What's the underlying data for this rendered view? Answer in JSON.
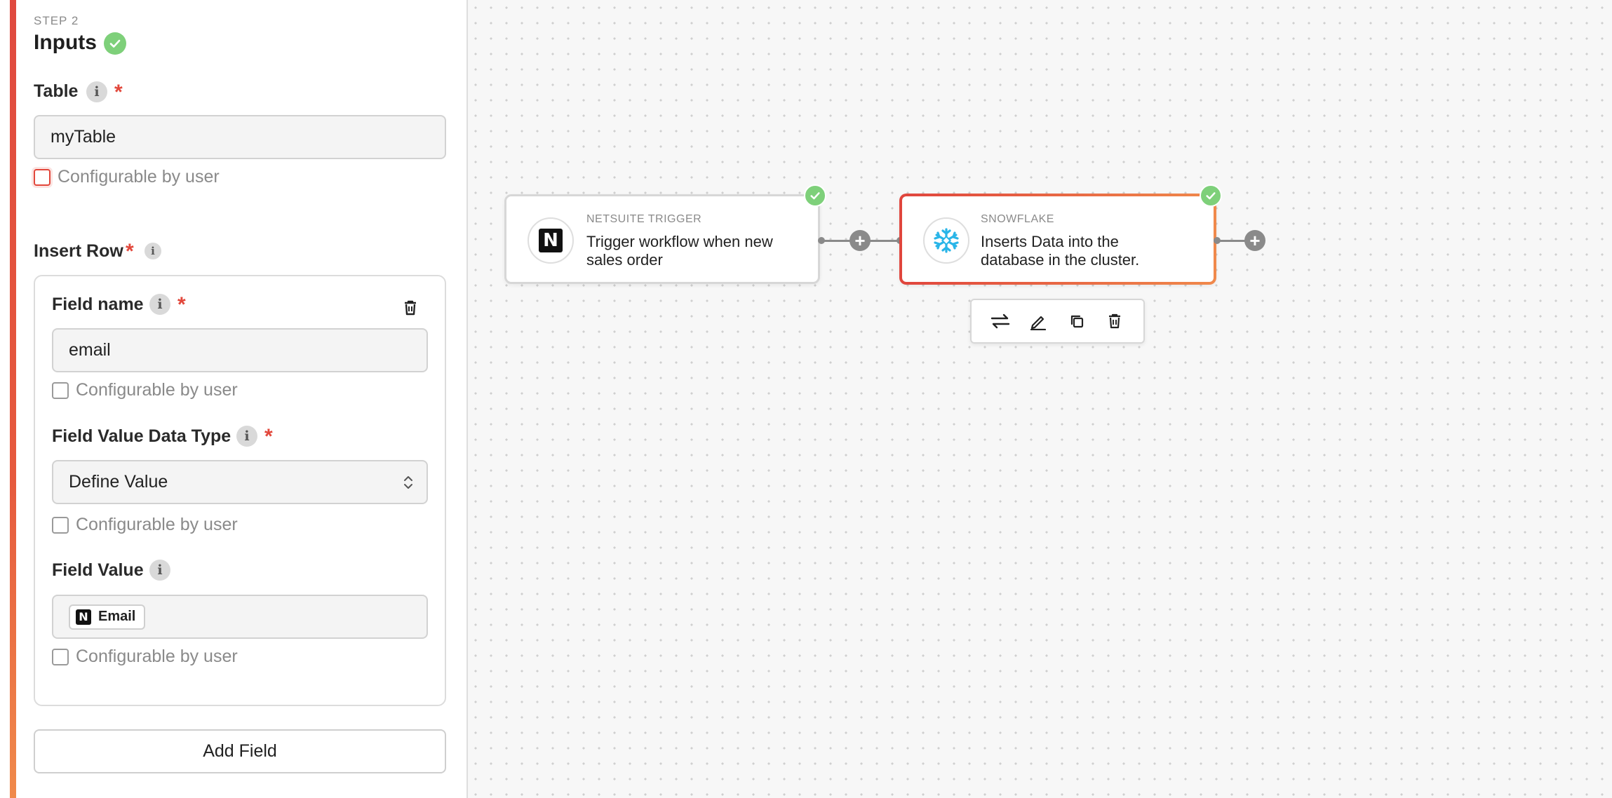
{
  "panel": {
    "step_label": "STEP 2",
    "title": "Inputs",
    "table": {
      "label": "Table",
      "required_mark": "*",
      "value": "myTable",
      "configurable_label": "Configurable by user"
    },
    "insert_row": {
      "label": "Insert Row",
      "required_mark": "*",
      "field_name": {
        "label": "Field name",
        "required_mark": "*",
        "value": "email",
        "configurable_label": "Configurable by user"
      },
      "field_value_data_type": {
        "label": "Field Value Data Type",
        "required_mark": "*",
        "selected": "Define Value",
        "configurable_label": "Configurable by user"
      },
      "field_value": {
        "label": "Field Value",
        "chip_label": "Email",
        "configurable_label": "Configurable by user"
      }
    },
    "add_field_label": "Add Field"
  },
  "canvas": {
    "nodes": [
      {
        "type_label": "NETSUITE TRIGGER",
        "description": "Trigger workflow when new sales order",
        "icon": "netsuite-logo-icon",
        "status": "complete"
      },
      {
        "type_label": "SNOWFLAKE",
        "description": "Inserts Data into the database in the cluster.",
        "icon": "snowflake-logo-icon",
        "status": "complete",
        "selected": true
      }
    ],
    "node_toolbar": [
      "swap-icon",
      "edit-icon",
      "duplicate-icon",
      "delete-icon"
    ]
  },
  "colors": {
    "accent_red": "#e2473b",
    "accent_orange": "#f0894b",
    "success_green": "#7ed07a",
    "snowflake_blue": "#29b5e8"
  }
}
